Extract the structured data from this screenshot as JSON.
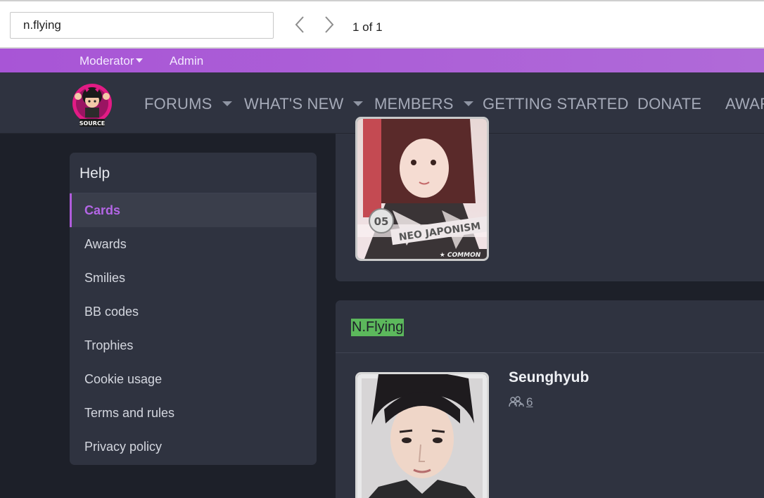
{
  "find": {
    "query": "n.flying",
    "count": "1 of 1"
  },
  "staff": {
    "moderator": "Moderator",
    "admin": "Admin"
  },
  "nav": {
    "items": [
      "FORUMS",
      "WHAT'S NEW",
      "MEMBERS",
      "GETTING STARTED",
      "DONATE",
      "AWAR"
    ]
  },
  "sidebar": {
    "title": "Help",
    "items": [
      "Cards",
      "Awards",
      "Smilies",
      "BB codes",
      "Trophies",
      "Cookie usage",
      "Terms and rules",
      "Privacy policy"
    ]
  },
  "card1": {
    "badge": "05",
    "set": "NEO JAPONISM",
    "rarity": "★ COMMON"
  },
  "group2": {
    "title": "N.Flying",
    "card_name": "Seunghyub",
    "owners": "6"
  },
  "colors": {
    "accent": "#b05cdc",
    "highlight": "#5cb85c",
    "panel": "#2f3340",
    "background": "#1d2029"
  },
  "icons": {
    "prev": "chevron-left-icon",
    "next": "chevron-right-icon",
    "owners": "users-icon"
  }
}
